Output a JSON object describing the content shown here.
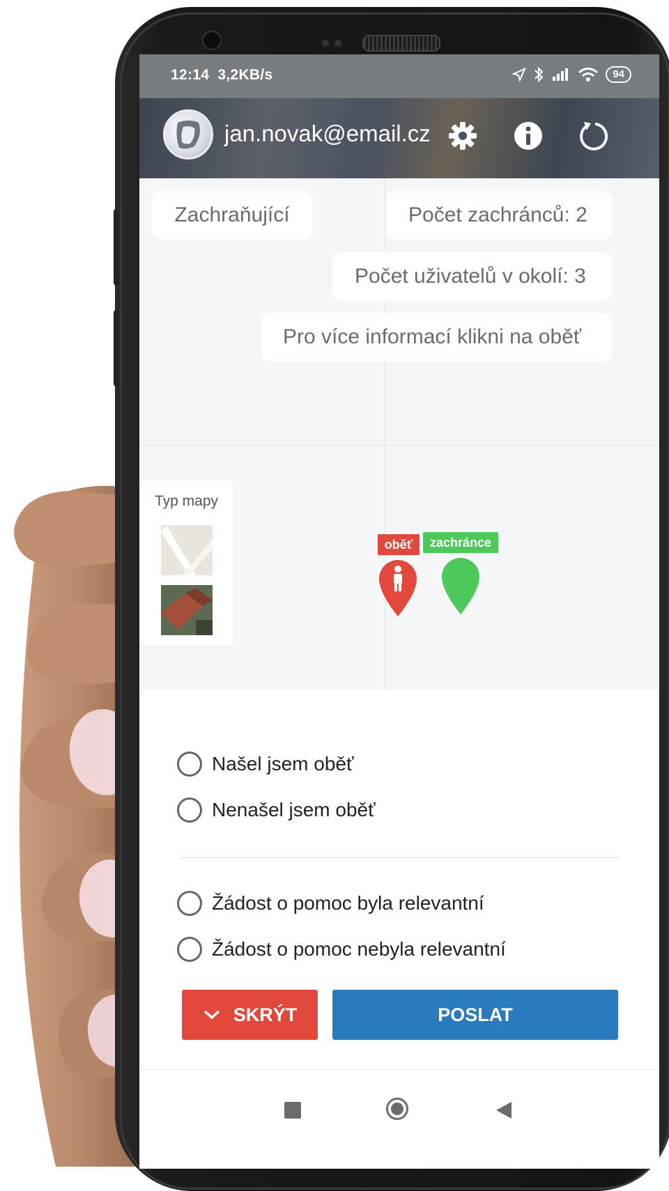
{
  "status_bar": {
    "time": "12:14",
    "speed": "3,2KB/s",
    "battery": "94"
  },
  "header": {
    "email": "jan.novak@email.cz",
    "background_color": "#4a5260"
  },
  "map": {
    "badges": {
      "role": "Zachraňující",
      "rescuers": "Počet zachránců: 2",
      "users_nearby": "Počet uživatelů v okolí: 3",
      "info_hint": "Pro více informací klikni na oběť"
    },
    "map_type": {
      "title": "Typ mapy",
      "options": [
        "map-view-thumbnail",
        "satellite-view-thumbnail"
      ]
    },
    "markers": {
      "victim_label": "oběť",
      "victim_color": "#e2493c",
      "rescuer_label": "zachránce",
      "rescuer_color": "#4cc95a"
    }
  },
  "feedback": {
    "found": "Našel jsem oběť",
    "not_found": "Nenašel jsem oběť",
    "relevant": "Žádost o pomoc byla relevantní",
    "not_relevant": "Žádost o pomoc nebyla relevantní"
  },
  "buttons": {
    "hide": "SKRÝT",
    "hide_color": "#e2493c",
    "send": "POSLAT",
    "send_color": "#2a7bbd"
  },
  "navigation": {
    "icons": [
      "recent-apps-icon",
      "home-icon",
      "back-icon"
    ]
  }
}
